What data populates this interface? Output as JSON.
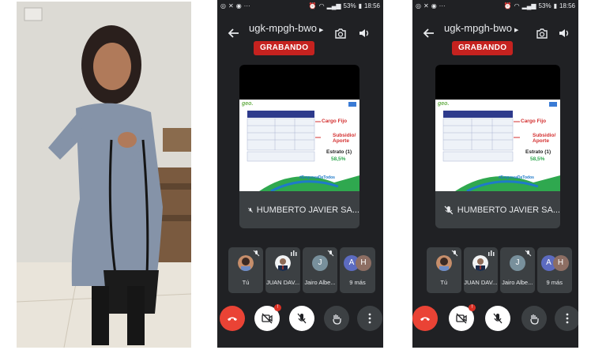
{
  "status_bar": {
    "battery": "53%",
    "time": "18:56"
  },
  "meeting": {
    "code": "ugk-mpgh-bwo",
    "recording_label": "GRABANDO"
  },
  "stage": {
    "presenter_name": "HUMBERTO JAVIER SA..."
  },
  "slide": {
    "logo": "geo.",
    "labels": [
      "Cargo Fijo",
      "Subsidio/ Aporte",
      "Estrato (1)",
      "58,5%"
    ],
    "footer": "#EmpresaDeTodos"
  },
  "participants": [
    {
      "name": "Tú"
    },
    {
      "name": "JUAN DAV..."
    },
    {
      "name": "Jairo Albe...",
      "initial": "J"
    },
    {
      "name": "9 más",
      "initials": [
        "A",
        "H"
      ]
    }
  ],
  "controls": {
    "video_badge": "!"
  },
  "colors": {
    "background": "#202124",
    "tile": "#3c4043",
    "hangup": "#ea4335",
    "recording": "#c5221f"
  }
}
